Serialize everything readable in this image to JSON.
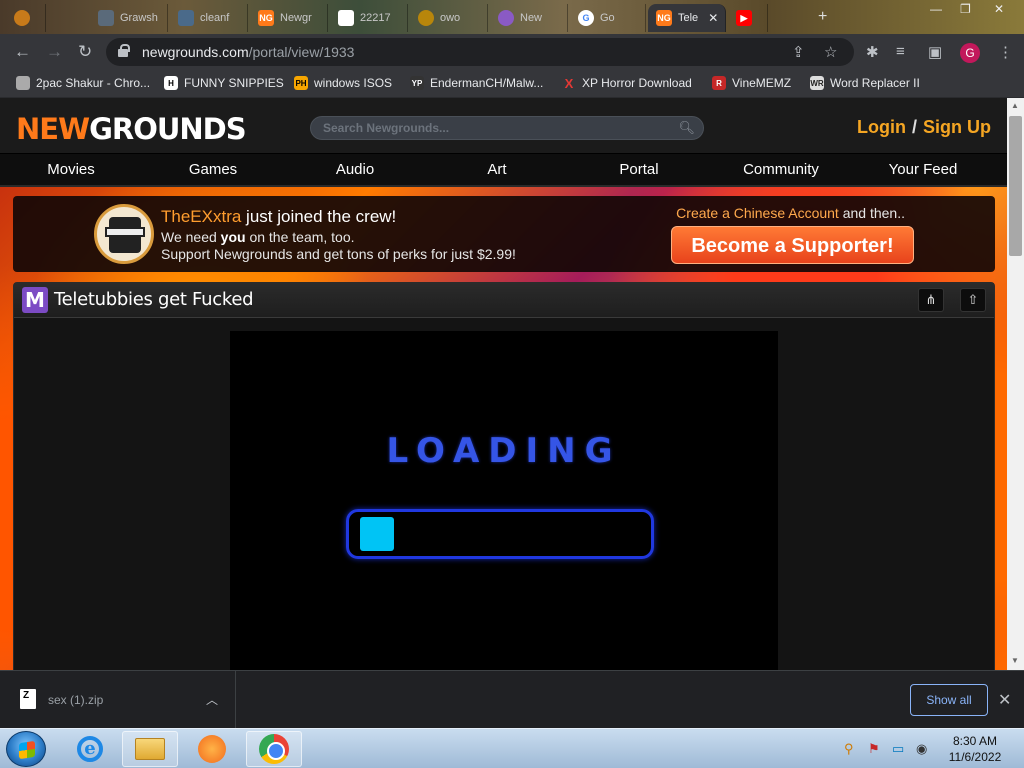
{
  "browser": {
    "tabs": [
      {
        "label": "",
        "icon": "chrome-profile-icon"
      },
      {
        "label": "Grawsh",
        "icon": "tab-icon"
      },
      {
        "label": "cleanf",
        "icon": "tab-icon"
      },
      {
        "label": "Newgr",
        "icon": "newgrounds-icon"
      },
      {
        "label": "22217",
        "icon": "blank-page-icon"
      },
      {
        "label": "owo",
        "icon": "tab-icon"
      },
      {
        "label": "New",
        "icon": "tab-icon"
      },
      {
        "label": "Go",
        "icon": "google-icon"
      },
      {
        "label": "Tele",
        "icon": "newgrounds-icon",
        "active": true
      },
      {
        "label": "",
        "icon": "youtube-icon"
      }
    ],
    "url_domain": "newgrounds.com",
    "url_path": "/portal/view/1933",
    "profile_initial": "G",
    "bookmarks": [
      {
        "label": "2pac Shakur - Chro...",
        "icon": "chrome-icon"
      },
      {
        "label": "FUNNY SNIPPIES",
        "icon": "h-icon"
      },
      {
        "label": "windows ISOS",
        "icon": "ph-icon"
      },
      {
        "label": "EndermanCH/Malw...",
        "icon": "yp-icon"
      },
      {
        "label": "XP Horror Download",
        "icon": "x-icon"
      },
      {
        "label": "VineMEMZ",
        "icon": "r-icon"
      },
      {
        "label": "Word Replacer II",
        "icon": "wr-icon"
      }
    ]
  },
  "ng": {
    "logo_a": "NEW",
    "logo_b": "GROUNDS",
    "search_placeholder": "Search Newgrounds...",
    "login": "Login",
    "auth_sep": "/",
    "signup": "Sign Up",
    "nav": [
      "Movies",
      "Games",
      "Audio",
      "Art",
      "Portal",
      "Community",
      "Your Feed"
    ],
    "promo": {
      "user": "TheEXxtra",
      "joined": " just joined the crew!",
      "line1_pre": "We need ",
      "line1_bold": "you",
      "line1_post": " on the team, too.",
      "line2": "Support Newgrounds and get tons of perks for just $2.99!",
      "create_link": "Create a Chinese Account",
      "and_then": " and then..",
      "supporter_btn": "Become a Supporter!"
    },
    "movie": {
      "type_letter": "M",
      "title": "Teletubbies get Fucked",
      "loading_text": "LOADING",
      "progress": 0.08
    }
  },
  "downloads": {
    "file": "sex (1).zip",
    "show_all": "Show all"
  },
  "taskbar": {
    "time": "8:30 AM",
    "date": "11/6/2022"
  },
  "colors": {
    "ng_orange": "#ff7a1a",
    "auth_gold": "#f5a623",
    "loading_blue": "#3555e6",
    "progress_cyan": "#00c4f5"
  }
}
